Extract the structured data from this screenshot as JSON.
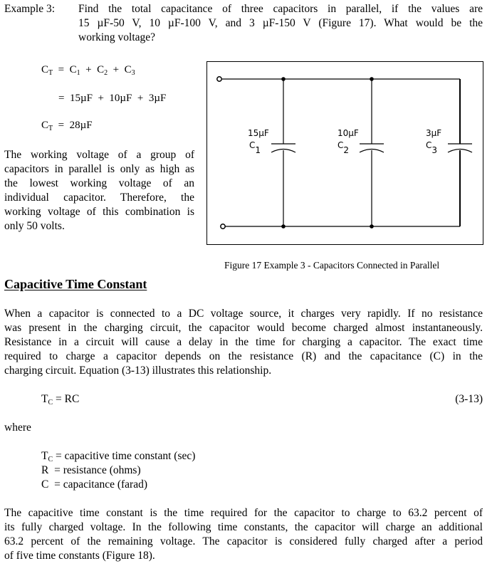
{
  "example": {
    "label": "Example 3:",
    "lines": [
      "Find the total capacitance of three capacitors in parallel, if the values are",
      "15 µF-50 V, 10 µF-100 V, and 3 µF-150 V (Figure 17).  What would be the",
      "working voltage?"
    ]
  },
  "equations": {
    "line1": {
      "lhs": "C",
      "lhs_sub": "T",
      "eq": "=",
      "terms": [
        {
          "sym": "C",
          "sub": "1"
        },
        {
          "sym": "C",
          "sub": "2"
        },
        {
          "sym": "C",
          "sub": "3"
        }
      ],
      "op": "+"
    },
    "line2": {
      "eq": "=",
      "text": "15µF  +  10µF  +  3µF"
    },
    "line3": {
      "lhs": "C",
      "lhs_sub": "T",
      "eq": "=",
      "text": "28µF"
    }
  },
  "working_voltage_paragraph": [
    "The working voltage of a group of",
    "capacitors in parallel is only as high as",
    "the lowest working voltage of an",
    "individual capacitor.  Therefore, the",
    "working voltage of this combination is",
    "only 50 volts."
  ],
  "figure": {
    "caption": "Figure 17  Example 3 - Capacitors Connected in Parallel",
    "capacitors": [
      {
        "value": "15µF",
        "name": "C",
        "sub": "1"
      },
      {
        "value": "10µF",
        "name": "C",
        "sub": "2"
      },
      {
        "value": "3µF",
        "name": "C",
        "sub": "3"
      }
    ]
  },
  "section": {
    "heading": "Capacitive Time Constant",
    "intro": [
      "When a capacitor is connected to a DC voltage source, it charges very rapidly.  If no resistance",
      "was present in the charging circuit, the capacitor would become charged almost instantaneously.",
      "Resistance in a circuit will cause a delay in the time for charging a capacitor.  The exact time",
      "required to charge a capacitor depends on the resistance (R) and the capacitance (C) in the",
      "charging circuit.  Equation (3-13) illustrates this relationship."
    ],
    "equation": {
      "lhs": "T",
      "lhs_sub": "C",
      "rhs": "= RC",
      "number": "(3-13)"
    },
    "where": "where",
    "definitions": [
      {
        "sym": "T",
        "sub": "C",
        "text": "= capacitive time constant (sec)"
      },
      {
        "sym": "R",
        "sub": "",
        "text": " = resistance (ohms)"
      },
      {
        "sym": "C",
        "sub": "",
        "text": " = capacitance (farad)"
      }
    ],
    "closing": [
      "The capacitive time constant is the time required for the capacitor to charge to 63.2 percent of",
      "its fully charged voltage.  In the following time constants, the capacitor will charge an additional",
      "63.2 percent of the remaining voltage.  The capacitor is considered fully charged after a period",
      "of five time constants (Figure 18)."
    ]
  }
}
